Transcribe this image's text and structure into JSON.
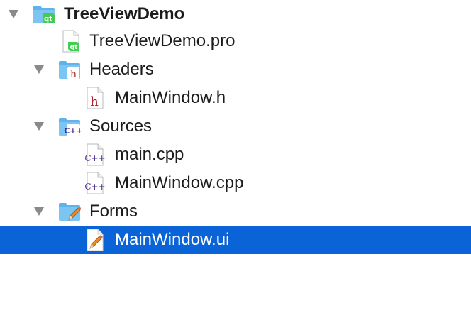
{
  "tree": {
    "project": {
      "label": "TreeViewDemo",
      "icon": "qt-project-folder-icon",
      "expanded": true
    },
    "pro_file": {
      "label": "TreeViewDemo.pro",
      "icon": "qt-pro-file-icon"
    },
    "headers": {
      "label": "Headers",
      "icon": "headers-folder-icon",
      "expanded": true,
      "files": [
        {
          "label": "MainWindow.h",
          "icon": "header-file-icon"
        }
      ]
    },
    "sources": {
      "label": "Sources",
      "icon": "sources-folder-icon",
      "expanded": true,
      "files": [
        {
          "label": "main.cpp",
          "icon": "cpp-file-icon"
        },
        {
          "label": "MainWindow.cpp",
          "icon": "cpp-file-icon"
        }
      ]
    },
    "forms": {
      "label": "Forms",
      "icon": "forms-folder-icon",
      "expanded": true,
      "files": [
        {
          "label": "MainWindow.ui",
          "icon": "ui-form-file-icon",
          "selected": true
        }
      ]
    }
  },
  "colors": {
    "selection": "#0a64d8",
    "folder_blue": "#5fb2ea",
    "qt_green": "#41cd52",
    "header_red": "#b22222",
    "cpp_purple": "#4b2a8c",
    "disclosure_gray": "#8a8a8a"
  }
}
